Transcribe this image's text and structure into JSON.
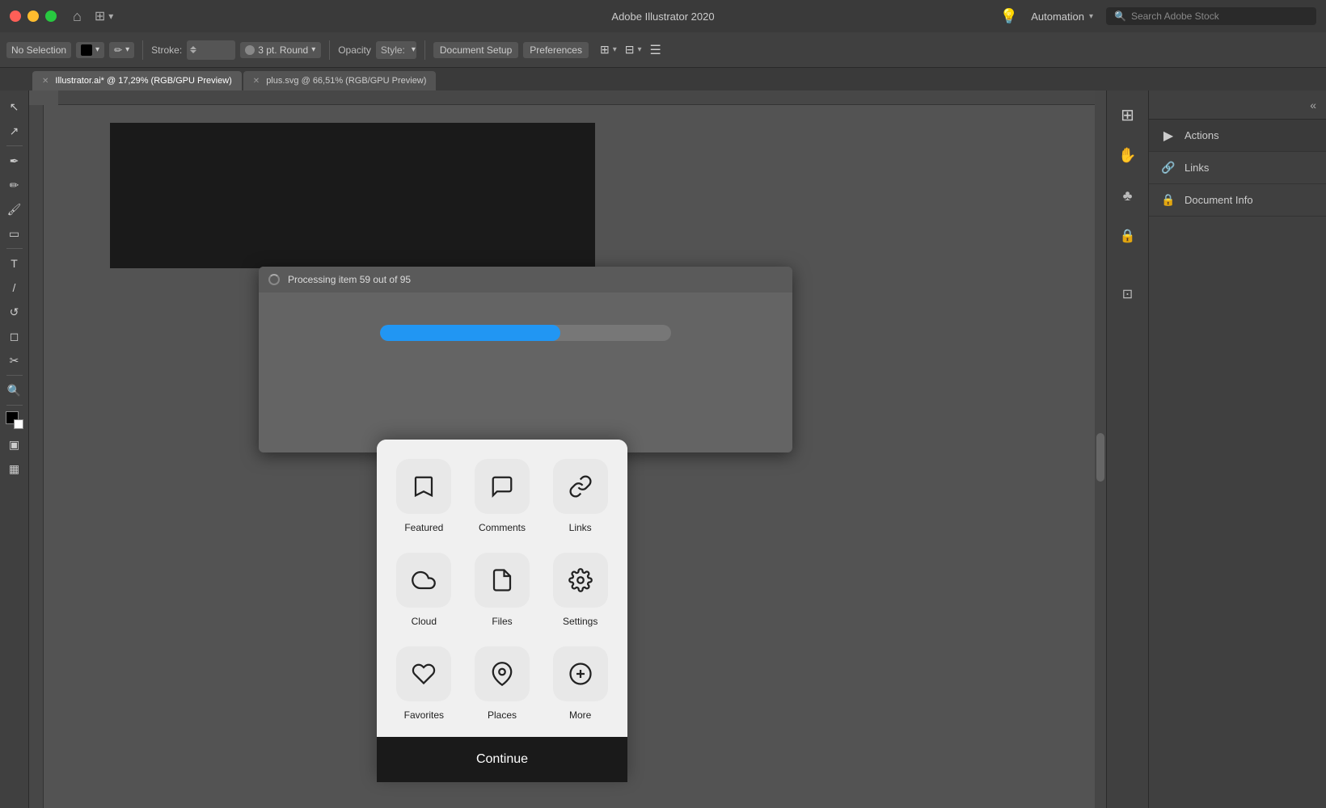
{
  "titlebar": {
    "title": "Adobe Illustrator 2020",
    "workspace": "Automation",
    "stock_search_placeholder": "Search Adobe Stock"
  },
  "toolbar": {
    "no_selection": "No Selection",
    "stroke_label": "Stroke:",
    "pt_round": "3 pt. Round",
    "opacity_label": "Opacity",
    "style_label": "Style:",
    "doc_setup": "Document Setup",
    "preferences": "Preferences"
  },
  "tabs": [
    {
      "label": "Illustrator.ai* @ 17,29% (RGB/GPU Preview)",
      "active": true
    },
    {
      "label": "plus.svg @ 66,51% (RGB/GPU Preview)",
      "active": false
    }
  ],
  "processing": {
    "text": "Processing item 59 out of 95",
    "progress_pct": 62
  },
  "right_panel": {
    "items": [
      {
        "label": "Actions",
        "icon": "▶"
      },
      {
        "label": "Links",
        "icon": "🔗"
      },
      {
        "label": "Document Info",
        "icon": "🔒"
      }
    ]
  },
  "mobile_app": {
    "grid_items": [
      {
        "label": "Featured",
        "icon": "bookmark"
      },
      {
        "label": "Comments",
        "icon": "comment"
      },
      {
        "label": "Links",
        "icon": "link"
      },
      {
        "label": "Cloud",
        "icon": "cloud"
      },
      {
        "label": "Files",
        "icon": "file"
      },
      {
        "label": "Settings",
        "icon": "settings"
      },
      {
        "label": "Favorites",
        "icon": "heart"
      },
      {
        "label": "Places",
        "icon": "location"
      },
      {
        "label": "More",
        "icon": "plus"
      }
    ],
    "continue_label": "Continue"
  }
}
